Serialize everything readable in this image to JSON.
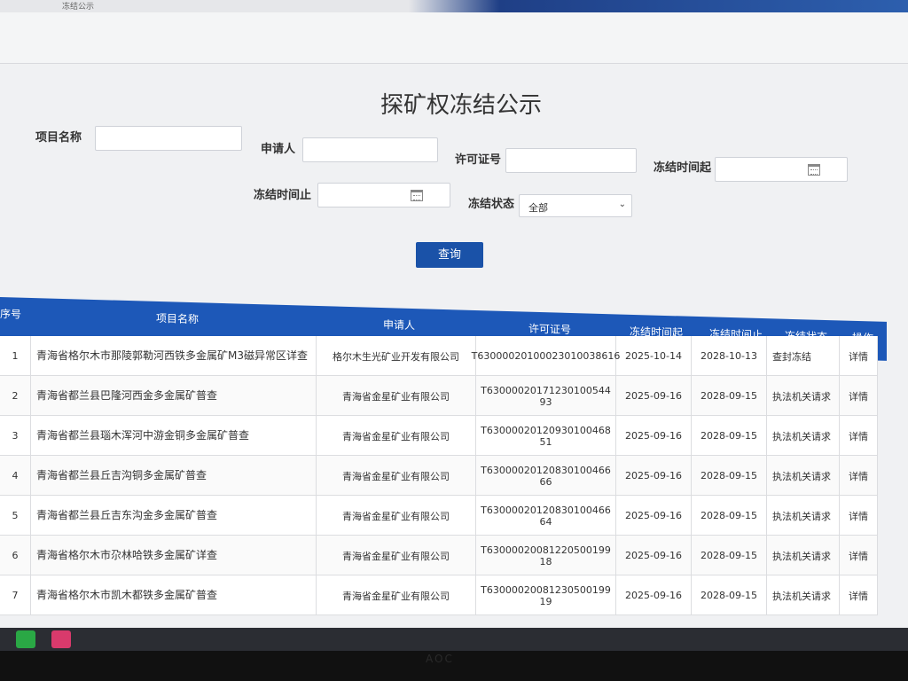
{
  "breadcrumb": "冻结公示",
  "page": {
    "title": "探矿权冻结公示"
  },
  "form": {
    "project_name_label": "项目名称",
    "applicant_label": "申请人",
    "license_label": "许可证号",
    "freeze_start_label": "冻结时间起",
    "freeze_end_label": "冻结时间止",
    "freeze_status_label": "冻结状态",
    "freeze_status_value": "全部",
    "query_button": "查询"
  },
  "table": {
    "headers": [
      "序号",
      "项目名称",
      "申请人",
      "许可证号",
      "冻结时间起",
      "冻结时间止",
      "冻结状态",
      "操作"
    ],
    "rows": [
      {
        "no": "1",
        "name": "青海省格尔木市那陵郭勒河西铁多金属矿M3磁异常区详查",
        "applicant": "格尔木生光矿业开发有限公司",
        "license": "T63000020100023010038616",
        "start": "2025-10-14",
        "end": "2028-10-13",
        "status": "查封冻结",
        "action": "详情"
      },
      {
        "no": "2",
        "name": "青海省都兰县巴隆河西金多金属矿普查",
        "applicant": "青海省金星矿业有限公司",
        "license": "T63000020171230100544​93",
        "start": "2025-09-16",
        "end": "2028-09-15",
        "status": "执法机关请求",
        "action": "详情"
      },
      {
        "no": "3",
        "name": "青海省都兰县瑙木浑河中游金铜多金属矿普查",
        "applicant": "青海省金星矿业有限公司",
        "license": "T63000020120930100468​51",
        "start": "2025-09-16",
        "end": "2028-09-15",
        "status": "执法机关请求",
        "action": "详情"
      },
      {
        "no": "4",
        "name": "青海省都兰县丘吉沟铜多金属矿普查",
        "applicant": "青海省金星矿业有限公司",
        "license": "T63000020120830100466​66",
        "start": "2025-09-16",
        "end": "2028-09-15",
        "status": "执法机关请求",
        "action": "详情"
      },
      {
        "no": "5",
        "name": "青海省都兰县丘吉东沟金多金属矿普查",
        "applicant": "青海省金星矿业有限公司",
        "license": "T63000020120830100466​64",
        "start": "2025-09-16",
        "end": "2028-09-15",
        "status": "执法机关请求",
        "action": "详情"
      },
      {
        "no": "6",
        "name": "青海省格尔木市尕林哈铁多金属矿详查",
        "applicant": "青海省金星矿业有限公司",
        "license": "T63000020081220500199​18",
        "start": "2025-09-16",
        "end": "2028-09-15",
        "status": "执法机关请求",
        "action": "详情"
      },
      {
        "no": "7",
        "name": "青海省格尔木市凯木都铁多金属矿普查",
        "applicant": "青海省金星矿业有限公司",
        "license": "T63000020081230500199​19",
        "start": "2025-09-16",
        "end": "2028-09-15",
        "status": "执法机关请求",
        "action": "详情"
      }
    ]
  },
  "monitor_brand": "AOC"
}
